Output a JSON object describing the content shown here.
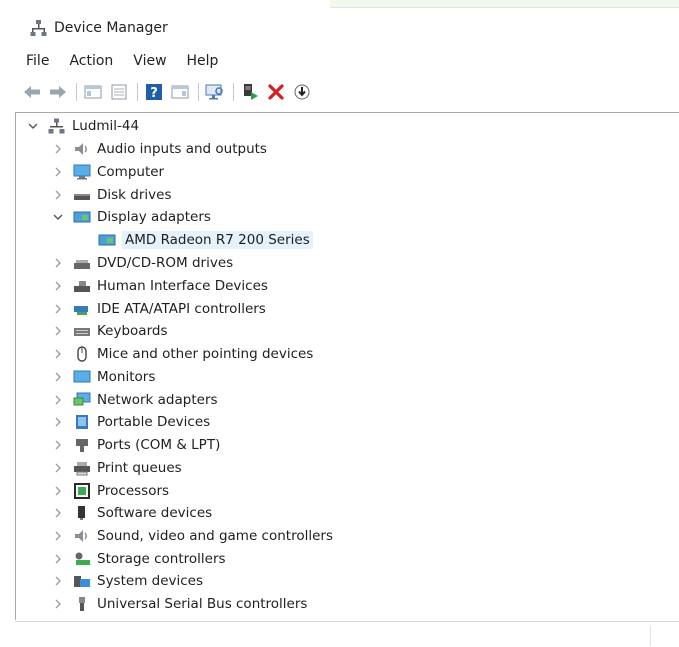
{
  "window": {
    "title": "Device Manager"
  },
  "menu": [
    "File",
    "Action",
    "View",
    "Help"
  ],
  "tree": {
    "computer_name": "Ludmil-44",
    "categories": [
      {
        "label": "Audio inputs and outputs",
        "icon": "speaker-icon",
        "expanded": false
      },
      {
        "label": "Computer",
        "icon": "monitor-icon",
        "expanded": false
      },
      {
        "label": "Disk drives",
        "icon": "disk-drive-icon",
        "expanded": false
      },
      {
        "label": "Display adapters",
        "icon": "display-adapter-icon",
        "expanded": true,
        "children": [
          "AMD Radeon R7 200 Series"
        ]
      },
      {
        "label": "DVD/CD-ROM drives",
        "icon": "dvd-drive-icon",
        "expanded": false
      },
      {
        "label": "Human Interface Devices",
        "icon": "hid-icon",
        "expanded": false
      },
      {
        "label": "IDE ATA/ATAPI controllers",
        "icon": "ide-controller-icon",
        "expanded": false
      },
      {
        "label": "Keyboards",
        "icon": "keyboard-icon",
        "expanded": false
      },
      {
        "label": "Mice and other pointing devices",
        "icon": "mouse-icon",
        "expanded": false
      },
      {
        "label": "Monitors",
        "icon": "monitor-icon",
        "expanded": false
      },
      {
        "label": "Network adapters",
        "icon": "network-adapter-icon",
        "expanded": false
      },
      {
        "label": "Portable Devices",
        "icon": "portable-device-icon",
        "expanded": false
      },
      {
        "label": "Ports (COM & LPT)",
        "icon": "port-icon",
        "expanded": false
      },
      {
        "label": "Print queues",
        "icon": "printer-icon",
        "expanded": false
      },
      {
        "label": "Processors",
        "icon": "processor-icon",
        "expanded": false
      },
      {
        "label": "Software devices",
        "icon": "software-device-icon",
        "expanded": false
      },
      {
        "label": "Sound, video and game controllers",
        "icon": "speaker-icon",
        "expanded": false
      },
      {
        "label": "Storage controllers",
        "icon": "storage-controller-icon",
        "expanded": false
      },
      {
        "label": "System devices",
        "icon": "system-device-icon",
        "expanded": false
      },
      {
        "label": "Universal Serial Bus controllers",
        "icon": "usb-icon",
        "expanded": false
      }
    ]
  }
}
